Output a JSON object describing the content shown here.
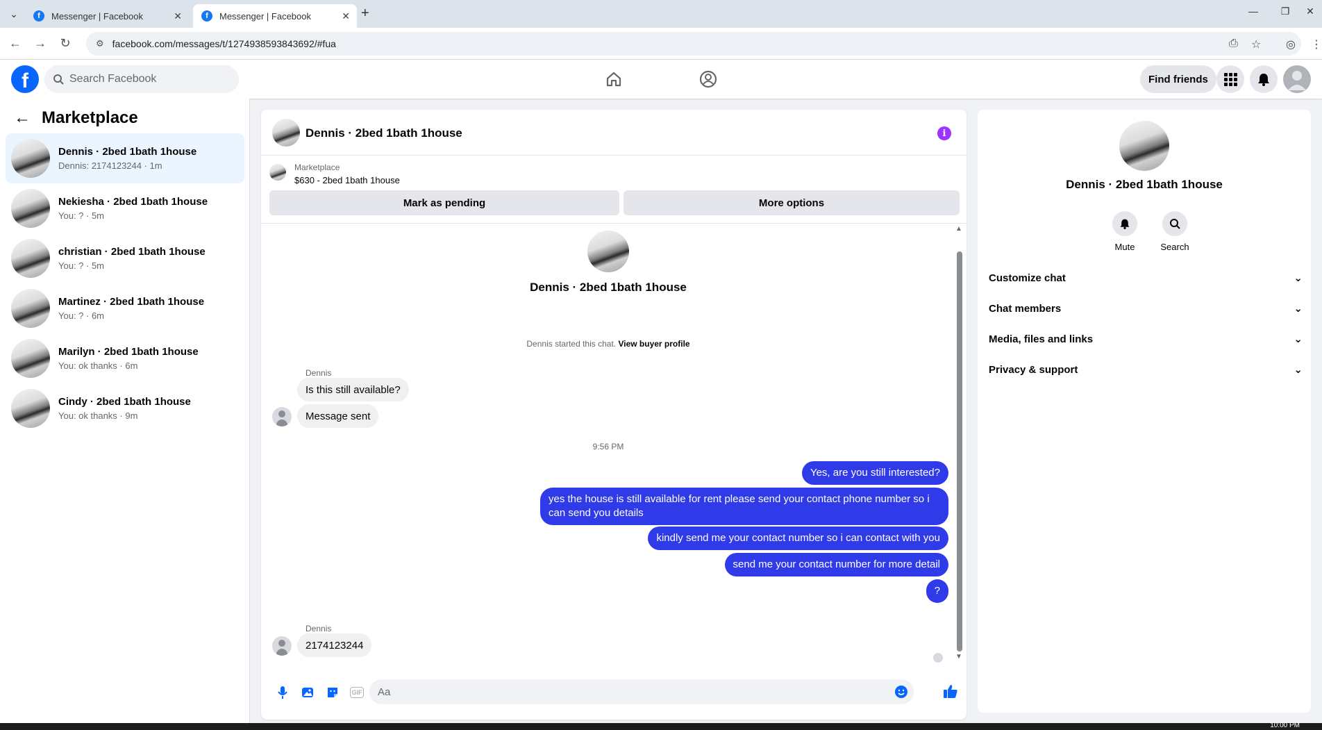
{
  "browser": {
    "tabs": [
      {
        "title": "Messenger | Facebook",
        "active": false
      },
      {
        "title": "Messenger | Facebook",
        "active": true
      }
    ],
    "url": "facebook.com/messages/t/1274938593843692/#fua"
  },
  "header": {
    "search_placeholder": "Search Facebook",
    "find_friends": "Find friends"
  },
  "sidebar": {
    "title": "Marketplace",
    "conversations": [
      {
        "name": "Dennis · 2bed 1bath 1house",
        "preview": "Dennis: 2174123244 · 1m",
        "active": true
      },
      {
        "name": "Nekiesha · 2bed 1bath 1house",
        "preview": "You: ? · 5m",
        "active": false
      },
      {
        "name": "christian · 2bed 1bath 1house",
        "preview": "You: ? · 5m",
        "active": false
      },
      {
        "name": "Martinez · 2bed 1bath 1house",
        "preview": "You: ? · 6m",
        "active": false
      },
      {
        "name": "Marilyn · 2bed 1bath 1house",
        "preview": "You: ok thanks · 6m",
        "active": false
      },
      {
        "name": "Cindy · 2bed 1bath 1house",
        "preview": "You: ok thanks · 9m",
        "active": false
      }
    ]
  },
  "chat": {
    "title": "Dennis · 2bed 1bath 1house",
    "marketplace_label": "Marketplace",
    "listing": "$630 - 2bed 1bath 1house",
    "mark_pending": "Mark as pending",
    "more_options": "More options",
    "thread_name": "Dennis · 2bed 1bath 1house",
    "started_text": "Dennis started this chat.",
    "view_buyer": "View buyer profile",
    "sender_name": "Dennis",
    "incoming_1": "Is this still available?",
    "incoming_2": "Message sent",
    "time_sep": "9:56 PM",
    "outgoing": [
      "Yes, are you still interested?",
      "yes the house is still available for rent please send your contact phone number so i can send you details",
      "kindly send me your contact number so i can contact with you",
      "send me your contact number for more detail",
      "?"
    ],
    "incoming_3": "2174123244",
    "composer_placeholder": "Aa",
    "gif_label": "GIF"
  },
  "details": {
    "name": "Dennis · 2bed 1bath 1house",
    "mute": "Mute",
    "search": "Search",
    "sections": [
      "Customize chat",
      "Chat members",
      "Media, files and links",
      "Privacy & support"
    ]
  },
  "taskbar": {
    "clock": "10:00 PM"
  },
  "colors": {
    "brand": "#0866ff",
    "outgoing_bubble": "#2f3ae8",
    "info": "#a033ff"
  }
}
